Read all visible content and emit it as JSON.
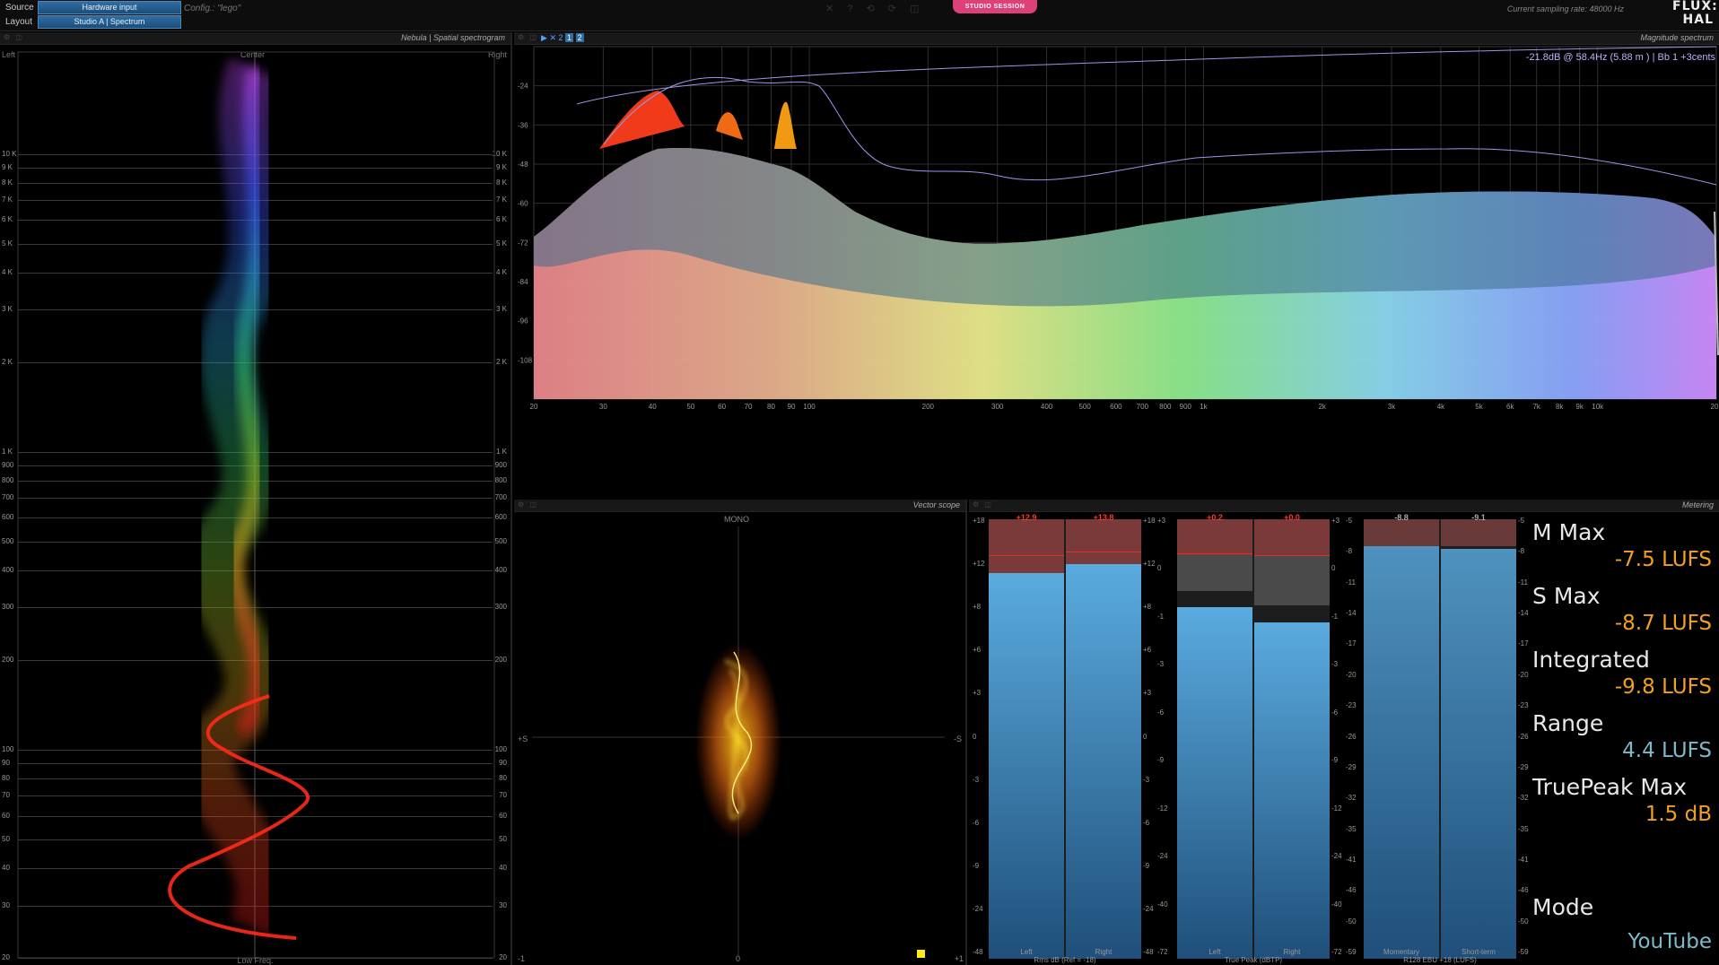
{
  "topbar": {
    "source_label": "Source",
    "source_value": "Hardware input",
    "layout_label": "Layout",
    "layout_value": "Studio A | Spectrum",
    "config_text": "Config.: \"lego\"",
    "session_badge": "STUDIO SESSION",
    "sampling_rate": "Current sampling rate: 48000 Hz",
    "logo_top": "FLUX:",
    "logo_bottom": "HAL"
  },
  "nebula": {
    "title": "Nebula | Spatial spectrogram",
    "left_label": "Left",
    "center_label": "Center",
    "right_label": "Right",
    "footer": "Low Freq.",
    "freq_ticks": [
      "10 K",
      "9 K",
      "8 K",
      "7 K",
      "6 K",
      "5 K",
      "4 K",
      "3 K",
      "2 K",
      "1 K",
      "900",
      "800",
      "700",
      "600",
      "500",
      "400",
      "300",
      "200",
      "100",
      "90",
      "80",
      "70",
      "60",
      "50",
      "40",
      "30",
      "20"
    ]
  },
  "spectrum": {
    "title": "Magnitude spectrum",
    "tools": [
      "▶",
      "✕",
      "2",
      "1",
      "2"
    ],
    "readout": "-21.8dB @    58.4Hz (5.88 m ) | Bb  1  +3cents",
    "db_ticks": [
      "-24",
      "-36",
      "-48",
      "-60",
      "-72",
      "-84",
      "-96",
      "-108"
    ],
    "freq_ticks": [
      "20",
      "30",
      "40",
      "50",
      "60",
      "70",
      "80",
      "90",
      "100",
      "200",
      "300",
      "400",
      "500",
      "600",
      "700",
      "800",
      "900",
      "1k",
      "2k",
      "3k",
      "4k",
      "5k",
      "6k",
      "7k",
      "8k",
      "9k",
      "10k",
      "20k"
    ]
  },
  "vectorscope": {
    "title": "Vector scope",
    "mono_label": "MONO",
    "plus_s": "+S",
    "minus_s": "-S",
    "bottom_left": "-1",
    "bottom_center": "0",
    "bottom_right": "+1"
  },
  "metering": {
    "title": "Metering",
    "rms": {
      "peaks": [
        "+12.9",
        "+13.8"
      ],
      "labels": [
        "Left",
        "Right"
      ],
      "footer": "Rms dB (Ref = -18)",
      "ticks": [
        "+18",
        "+12",
        "+8",
        "+6",
        "+3",
        "0",
        "-3",
        "-6",
        "-9",
        "-24",
        "-48"
      ]
    },
    "truepeak": {
      "peaks": [
        "+0.2",
        "+0.0"
      ],
      "labels": [
        "Left",
        "Right"
      ],
      "footer": "True Peak (dBTP)",
      "ticks": [
        "+3",
        "0",
        "-1",
        "-3",
        "-6",
        "-9",
        "-12",
        "-24",
        "-40",
        "-72"
      ]
    },
    "r128": {
      "peaks": [
        "-8.8",
        "-9.1"
      ],
      "labels": [
        "Momentary",
        "Short-term"
      ],
      "footer": "R128 EBU +18 (LUFS)",
      "ticks": [
        "-5",
        "-8",
        "-11",
        "-14",
        "-17",
        "-20",
        "-23",
        "-26",
        "-29",
        "-32",
        "-35",
        "-41",
        "-46",
        "-50",
        "-59"
      ]
    },
    "stats": [
      {
        "name": "M Max",
        "value": "-7.5 LUFS",
        "color": "#f2a11e"
      },
      {
        "name": "S Max",
        "value": "-8.7 LUFS",
        "color": "#f2a11e"
      },
      {
        "name": "Integrated",
        "value": "-9.8 LUFS",
        "color": "#f2a11e"
      },
      {
        "name": "Range",
        "value": "4.4 LUFS",
        "color": "#7fb9c9"
      },
      {
        "name": "TruePeak Max",
        "value": "1.5 dB",
        "color": "#f2a11e"
      }
    ],
    "mode_label": "Mode",
    "mode_value": "YouTube"
  }
}
